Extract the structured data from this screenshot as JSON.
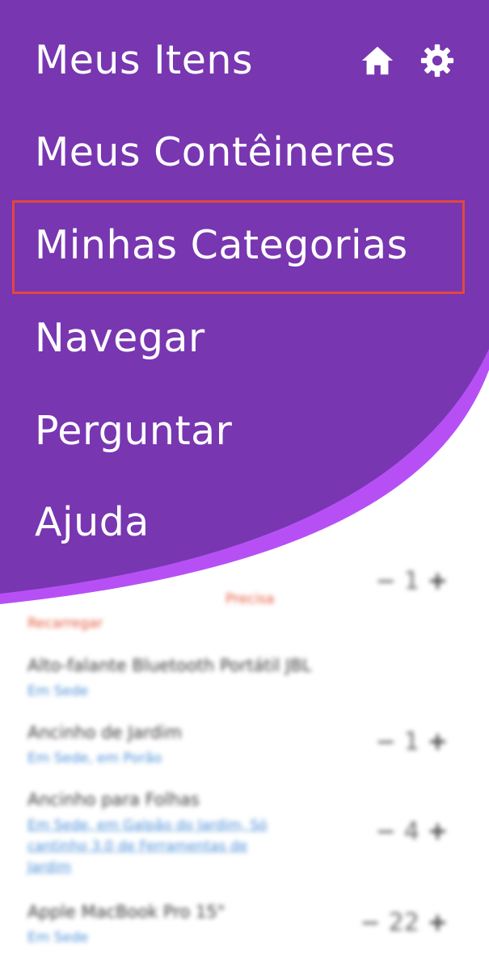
{
  "drawer": {
    "menu": [
      {
        "label": "Meus Itens"
      },
      {
        "label": "Meus Contêineres"
      },
      {
        "label": "Minhas Categorias"
      },
      {
        "label": "Navegar"
      },
      {
        "label": "Perguntar"
      },
      {
        "label": "Ajuda"
      }
    ],
    "icons": [
      "home-icon",
      "gear-icon"
    ],
    "colors": {
      "drawer": "#7836b1",
      "accent_arc": "#b650f5",
      "highlight_border": "#e3473c"
    }
  },
  "list": {
    "items": [
      {
        "subtitle": "Precisa",
        "subtitle_line2": "Recarregar",
        "count": "1"
      },
      {
        "title": "Alto-falante Bluetooth Portátil JBL",
        "subtitle": "Em Sede"
      },
      {
        "title": "Ancinho de Jardim",
        "subtitle": "Em Sede, em Porão",
        "count": "1"
      },
      {
        "title": "Ancinho para Folhas",
        "subtitle": "Em Sede, em Galpão do Jardim, Só",
        "subtitle_line2": "cantinho 3.0 de Ferramentas de",
        "subtitle_line3": "Jardim",
        "count": "4"
      },
      {
        "title": "Apple MacBook Pro 15\"",
        "subtitle": "Em Sede",
        "count": "22"
      }
    ],
    "stepper": {
      "minus": "−",
      "plus": "+"
    }
  }
}
